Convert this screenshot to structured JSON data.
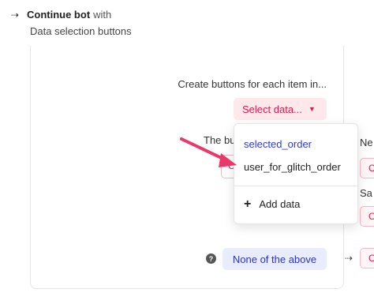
{
  "header": {
    "arrow_glyph": "⇢",
    "title_strong": "Continue bot",
    "title_light": "with",
    "subtitle": "Data selection buttons"
  },
  "card": {
    "create_text": "Create buttons for each item in...",
    "select_label": "Select data...",
    "partial_label": "The bu",
    "partial_button_glyph": "C"
  },
  "dropdown": {
    "items": [
      {
        "label": "selected_order",
        "selected": true
      },
      {
        "label": "user_for_glitch_order",
        "selected": false
      }
    ],
    "add_label": "Add data"
  },
  "right_column": {
    "text_1": "Ne",
    "text_2": "Sa",
    "pink_glyph": "C"
  },
  "footer_row": {
    "help_glyph": "?",
    "none_label": "None of the above",
    "arrow_glyph": "⇢"
  },
  "colors": {
    "accent_pink": "#e0194a",
    "pink_bg": "#fde8ec",
    "blue_text": "#2b34c8",
    "blue_bg": "#e8ecfb",
    "pointer_arrow": "#e8396a"
  }
}
